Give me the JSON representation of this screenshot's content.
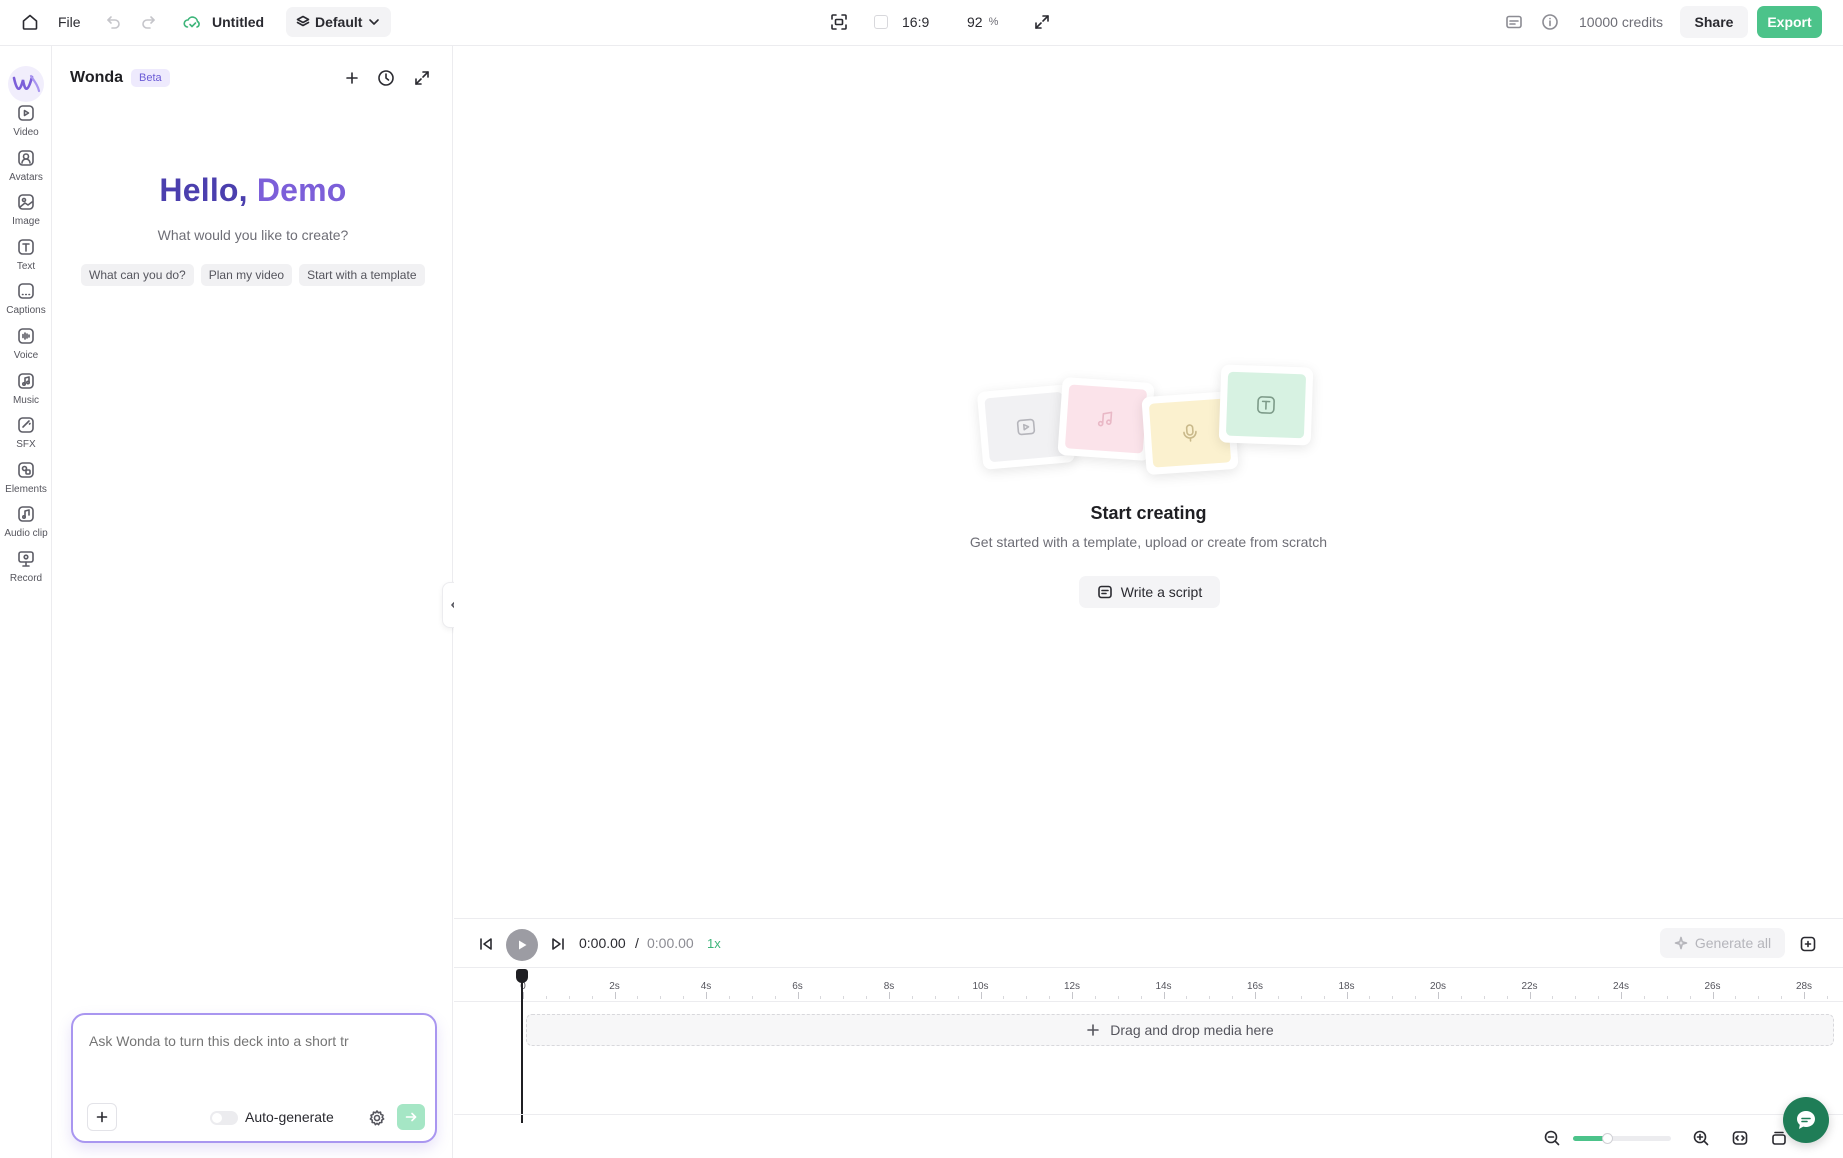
{
  "topbar": {
    "file_label": "File",
    "project_title": "Untitled",
    "layer_preset": "Default",
    "aspect_ratio": "16:9",
    "zoom_value": "92",
    "zoom_unit": "%",
    "credits": "10000 credits",
    "share_label": "Share",
    "export_label": "Export",
    "accent_color": "#4cc38a"
  },
  "sidebar": {
    "items": [
      {
        "label": "Video",
        "icon": "video-icon"
      },
      {
        "label": "Avatars",
        "icon": "avatar-icon"
      },
      {
        "label": "Image",
        "icon": "image-icon"
      },
      {
        "label": "Text",
        "icon": "text-icon"
      },
      {
        "label": "Captions",
        "icon": "captions-icon"
      },
      {
        "label": "Voice",
        "icon": "voice-icon"
      },
      {
        "label": "Music",
        "icon": "music-icon"
      },
      {
        "label": "SFX",
        "icon": "sfx-icon"
      },
      {
        "label": "Elements",
        "icon": "elements-icon"
      },
      {
        "label": "Audio clip",
        "icon": "audio-clip-icon"
      },
      {
        "label": "Record",
        "icon": "record-icon"
      }
    ]
  },
  "panel": {
    "title": "Wonda",
    "badge": "Beta",
    "greeting_prefix": "Hello,",
    "greeting_name": "Demo",
    "subtitle": "What would you like to create?",
    "chips": [
      "What can you do?",
      "Plan my video",
      "Start with a template"
    ],
    "composer_placeholder": "Ask Wonda to turn this deck into a short tr",
    "auto_generate_label": "Auto-generate",
    "auto_generate_on": false
  },
  "canvas": {
    "empty_title": "Start creating",
    "empty_subtitle": "Get started with a template, upload or create from scratch",
    "write_script_label": "Write a script"
  },
  "timeline": {
    "current_time": "0:00.00",
    "separator": "/",
    "total_time": "0:00.00",
    "speed": "1x",
    "generate_all_label": "Generate all",
    "ticks": [
      "0",
      "2s",
      "4s",
      "6s",
      "8s",
      "10s",
      "12s",
      "14s",
      "16s",
      "18s",
      "20s",
      "22s",
      "24s",
      "26s",
      "28s"
    ],
    "dropzone_label": "Drag and drop media here",
    "zoom_level": 0.35
  }
}
